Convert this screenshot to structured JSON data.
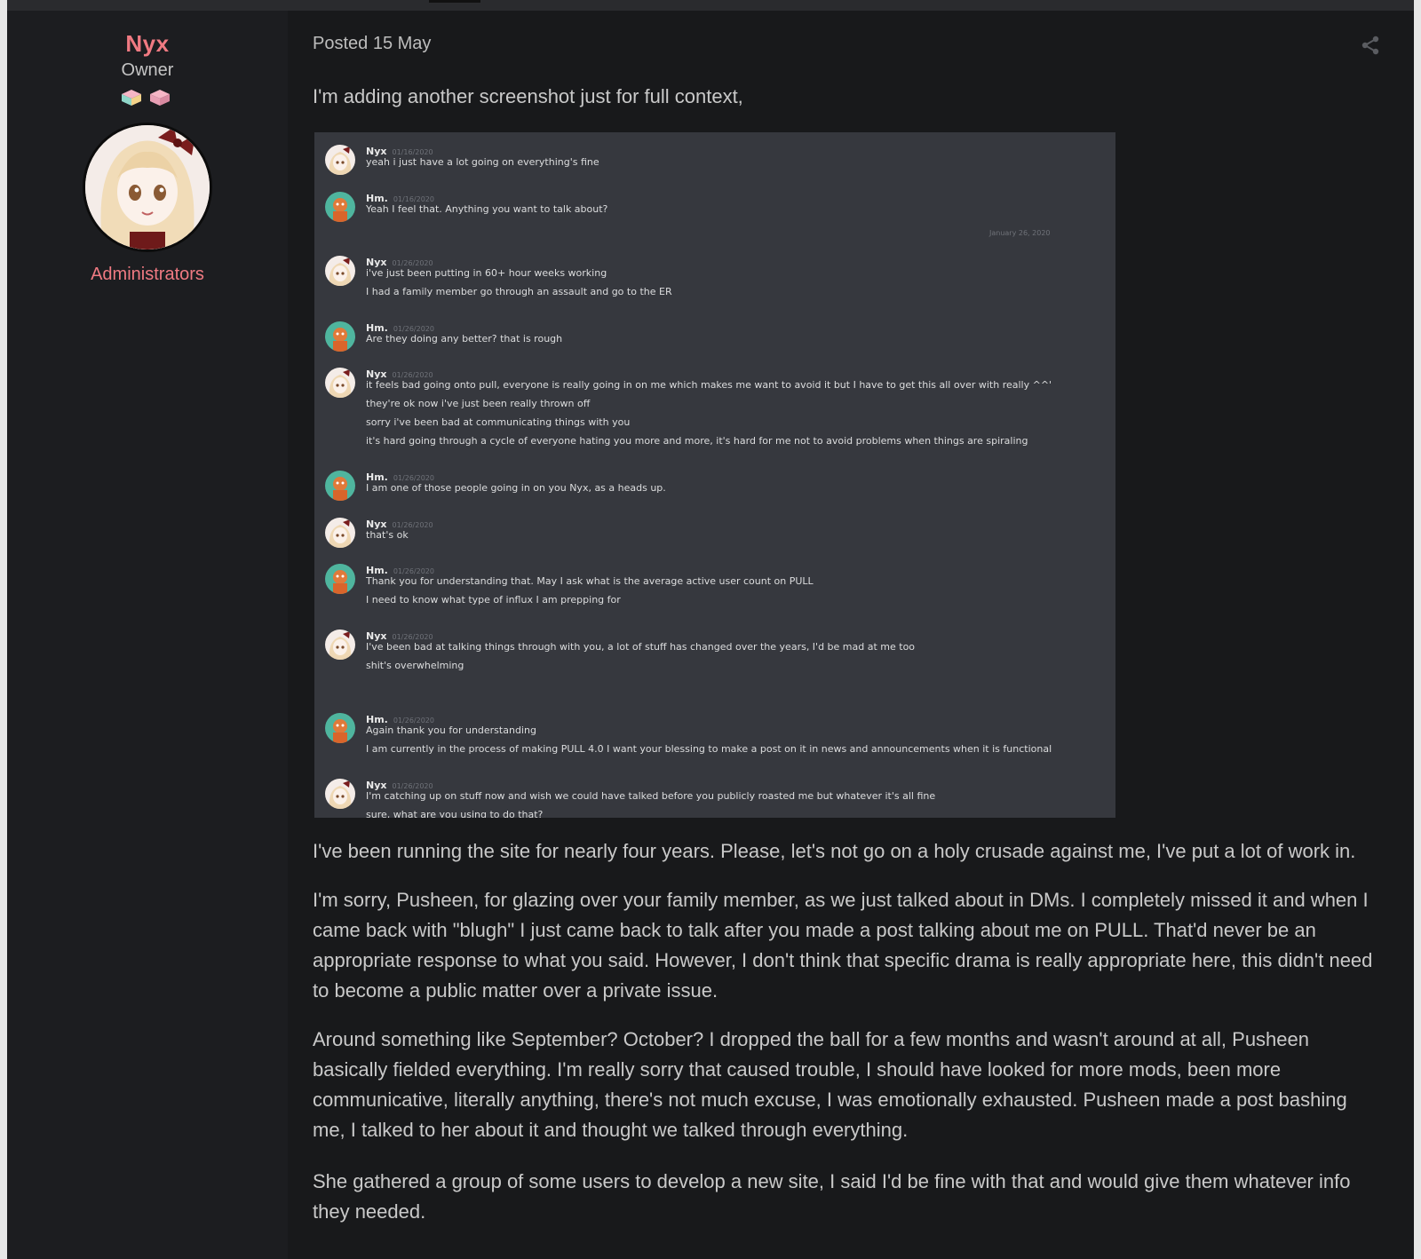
{
  "author": {
    "name": "Nyx",
    "title": "Owner",
    "group": "Administrators",
    "avatar_icon": "anime-avatar",
    "badge_icons": [
      "pink-cube-icon",
      "pink-cube-icon"
    ]
  },
  "post": {
    "posted": "Posted 15 May",
    "share_icon": "share-icon",
    "paragraphs": [
      "I'm adding another screenshot just for full context,",
      "I've been running the site for nearly four years. Please, let's not go on a holy crusade against me, I've put a lot of work in.",
      "I'm sorry, Pusheen, for glazing over your family member, as we just talked about in DMs. I completely missed it and when I came back with \"blugh\" I just came back to talk after you made a post talking about me on PULL. That'd never be an appropriate response to what you said. However, I don't think that specific drama is really appropriate here, this didn't need to become a public matter over a private issue.",
      "Around something like September? October? I dropped the ball for a few months and wasn't around at all, Pusheen basically fielded everything. I'm really sorry that caused trouble, I should have looked for more mods, been more communicative, literally anything, there's not much excuse, I was emotionally exhausted. Pusheen made a post bashing me, I talked to her about it and thought we talked through everything.",
      "She gathered a group of some users to develop a new site, I said I'd be fine with that and would give them whatever info they needed."
    ]
  },
  "chat": {
    "date_divider": "January 26, 2020",
    "messages": [
      {
        "user": "Nyx",
        "time": "01/16/2020",
        "lines": [
          "yeah i just have a lot going on everything's fine"
        ]
      },
      {
        "user": "Hm.",
        "time": "01/16/2020",
        "lines": [
          "Yeah I feel that. Anything you want to talk about?"
        ]
      },
      {
        "user": "Nyx",
        "time": "01/26/2020",
        "lines": [
          "i've just been putting in 60+ hour weeks working",
          "I had a family member go through an assault and go to the ER"
        ]
      },
      {
        "user": "Hm.",
        "time": "01/26/2020",
        "lines": [
          "Are they doing any better? that is rough"
        ]
      },
      {
        "user": "Nyx",
        "time": "01/26/2020",
        "lines": [
          "it feels bad going onto pull, everyone is really going in on me which makes me want to avoid it but I have to get this all over with really ^^'",
          "they're ok now i've just been really thrown off",
          "sorry i've been bad at communicating things with you",
          "it's hard going through a cycle of everyone hating you more and more, it's hard for me not to avoid problems when things are spiraling"
        ]
      },
      {
        "user": "Hm.",
        "time": "01/26/2020",
        "lines": [
          "I am one of those people going in on you Nyx, as a heads up."
        ]
      },
      {
        "user": "Nyx",
        "time": "01/26/2020",
        "lines": [
          "that's ok"
        ]
      },
      {
        "user": "Hm.",
        "time": "01/26/2020",
        "lines": [
          "Thank you for understanding that. May I ask what is the average active user count on PULL",
          "I need to know what type of influx I am prepping for"
        ]
      },
      {
        "user": "Nyx",
        "time": "01/26/2020",
        "lines": [
          "I've been bad at talking things through with you, a lot of stuff has changed over the years, I'd be mad at me too",
          "shit's overwhelming"
        ]
      },
      {
        "user": "Hm.",
        "time": "01/26/2020",
        "lines": [
          "Again thank you for understanding",
          "I am currently in the process of making PULL 4.0 I want your blessing to make a post on it in news and announcements when it is functional"
        ]
      },
      {
        "user": "Nyx",
        "time": "01/26/2020",
        "lines": [
          "I'm catching up on stuff now and wish we could have talked before you publicly roasted me but whatever it's all fine",
          "sure, what are you using to do that?"
        ]
      }
    ]
  }
}
